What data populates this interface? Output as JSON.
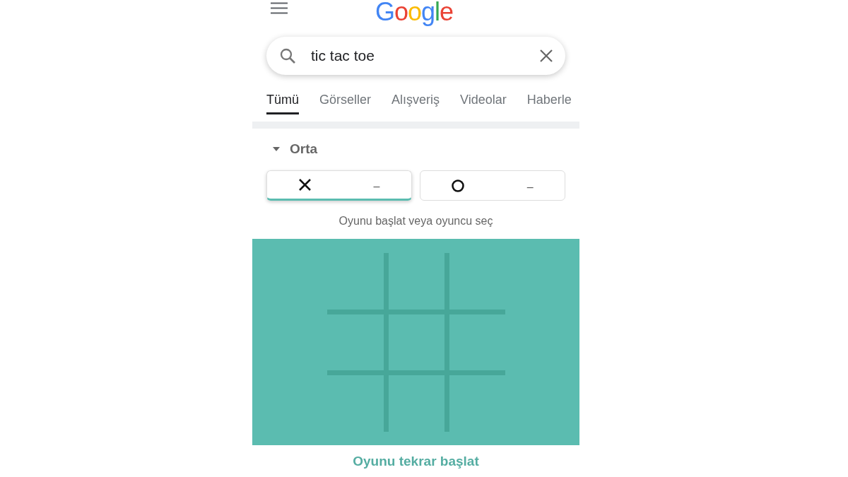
{
  "header": {
    "logo": "Google"
  },
  "search": {
    "value": "tic tac toe"
  },
  "tabs": [
    {
      "label": "Tümü",
      "selected": true
    },
    {
      "label": "Görseller",
      "selected": false
    },
    {
      "label": "Alışveriş",
      "selected": false
    },
    {
      "label": "Videolar",
      "selected": false
    },
    {
      "label": "Haberle",
      "selected": false
    }
  ],
  "game": {
    "difficulty": "Orta",
    "expanded": true,
    "players": [
      {
        "kind": "x",
        "score": "–",
        "selected": true
      },
      {
        "kind": "o",
        "score": "–",
        "selected": false
      }
    ],
    "hint": "Oyunu başlat veya oyuncu seç",
    "restart": "Oyunu tekrar başlat"
  }
}
